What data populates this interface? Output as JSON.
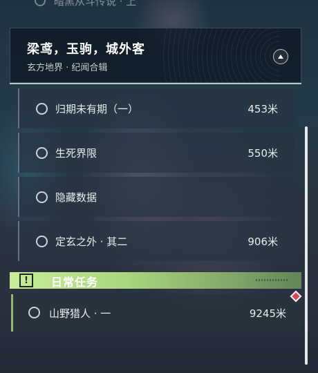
{
  "previous_item_partial": "暗黑从斗传说 · 上",
  "chapter": {
    "title": "梁鸢，玉驹，城外客",
    "subtitle": "玄方地界 · 纪闻合辑"
  },
  "quests": [
    {
      "name": "归期未有期（一）",
      "distance": "453米"
    },
    {
      "name": "生死界限",
      "distance": "550米"
    },
    {
      "name": "隐藏数据",
      "distance": ""
    },
    {
      "name": "定玄之外 · 其二",
      "distance": "906米"
    }
  ],
  "daily": {
    "title": "日常任务",
    "icon": "alert-icon",
    "icon_glyph": "!",
    "quest": {
      "name": "山野猎人 · 一",
      "distance": "9245米"
    }
  },
  "colors": {
    "accent_green": "#bfe591",
    "pin_red": "#d9475a"
  }
}
